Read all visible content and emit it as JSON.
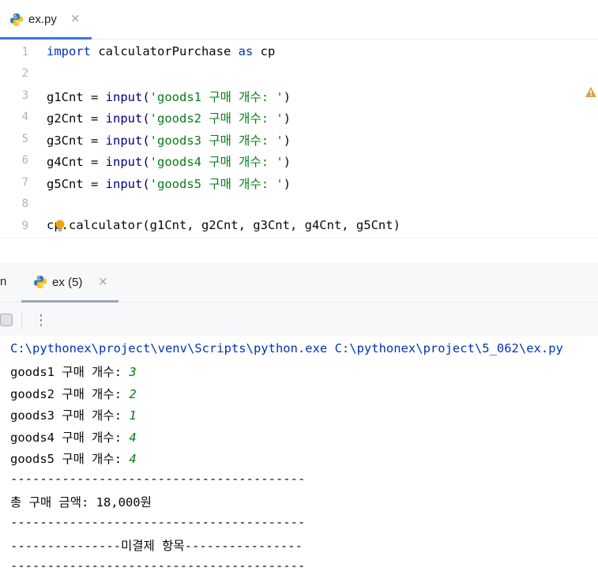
{
  "editor_tab": {
    "label": "ex.py",
    "close": "×",
    "icon": "python-icon"
  },
  "editor": {
    "line_numbers": [
      "1",
      "2",
      "3",
      "4",
      "5",
      "6",
      "7",
      "8",
      "9"
    ],
    "lines": [
      {
        "kw1": "import",
        "text1": " calculatorPurchase ",
        "kw2": "as",
        "text2": " cp"
      },
      {},
      {
        "var": "g1Cnt = ",
        "fn": "input",
        "open": "(",
        "str": "'goods1 구매 개수: '",
        "close": ")"
      },
      {
        "var": "g2Cnt = ",
        "fn": "input",
        "open": "(",
        "str": "'goods2 구매 개수: '",
        "close": ")"
      },
      {
        "var": "g3Cnt = ",
        "fn": "input",
        "open": "(",
        "str": "'goods3 구매 개수: '",
        "close": ")"
      },
      {
        "var": "g4Cnt = ",
        "fn": "input",
        "open": "(",
        "str": "'goods4 구매 개수: '",
        "close": ")"
      },
      {
        "var": "g5Cnt = ",
        "fn": "input",
        "open": "(",
        "str": "'goods5 구매 개수: '",
        "close": ")"
      },
      {},
      {
        "text": "cp.calculator(g1Cnt, g2Cnt, g3Cnt, g4Cnt, g5Cnt)"
      }
    ],
    "warning_icon": "warning-icon",
    "bulb_icon": "intention-bulb-icon"
  },
  "run_tabs": {
    "prev_label": "n",
    "active": {
      "label": "ex (5)",
      "close": "×",
      "icon": "python-icon"
    }
  },
  "toolbar": {
    "stop_icon": "stop-icon",
    "more_icon": "⋮"
  },
  "console": {
    "command": "C:\\pythonex\\project\\venv\\Scripts\\python.exe C:\\pythonex\\project\\5_062\\ex.py",
    "prompts": [
      {
        "prompt": "goods1 구매 개수: ",
        "value": "3"
      },
      {
        "prompt": "goods2 구매 개수: ",
        "value": "2"
      },
      {
        "prompt": "goods3 구매 개수: ",
        "value": "1"
      },
      {
        "prompt": "goods4 구매 개수: ",
        "value": "4"
      },
      {
        "prompt": "goods5 구매 개수: ",
        "value": "4"
      }
    ],
    "divider1": "----------------------------------------",
    "total": "총 구매 금액: 18,000원",
    "divider2": "----------------------------------------",
    "unpaid_header": "---------------미결제 항목----------------",
    "divider3": "----------------------------------------"
  },
  "colors": {
    "accent": "#3574f0",
    "keyword": "#0033b3",
    "string": "#067d17"
  }
}
